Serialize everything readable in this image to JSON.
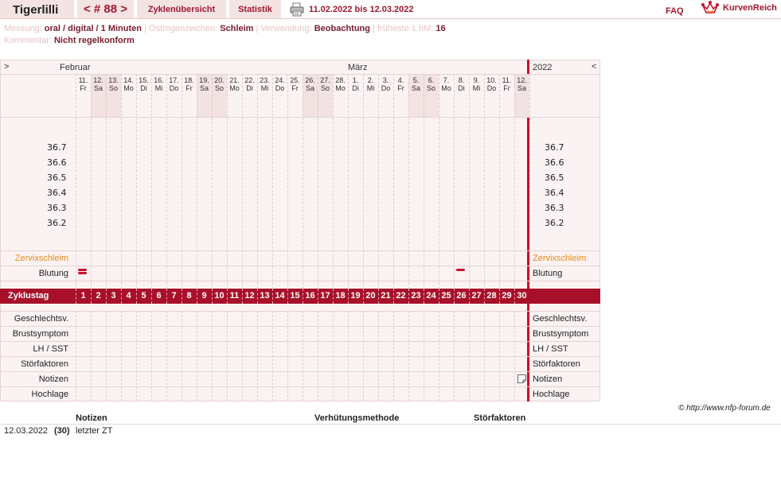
{
  "header": {
    "title": "Tigerlilli",
    "cycle_nav": "< # 88 >",
    "tab_overview": "Zyklenübersicht",
    "tab_stats": "Statistik",
    "date_range": "11.02.2022 bis 12.03.2022",
    "faq": "FAQ",
    "logo_text": "KurvenReich"
  },
  "info": {
    "measurement_label": "Messung:",
    "measurement_value": "oral / digital / 1 Minuten",
    "estrogen_label": "Östrogenzeichen:",
    "estrogen_value": "Schleim",
    "usage_label": "Verwendung:",
    "usage_value": "Beobachtung",
    "earliest_label": "früheste 1.hM:",
    "earliest_value": "16",
    "comment_label": "Kommentar:",
    "comment_value": "Nicht regelkonform"
  },
  "chart": {
    "nav_left": ">",
    "nav_right": "<",
    "month_feb": "Februar",
    "month_mar": "März",
    "year": "2022",
    "days": [
      {
        "d": "11.",
        "w": "Fr",
        "we": false
      },
      {
        "d": "12.",
        "w": "Sa",
        "we": true
      },
      {
        "d": "13.",
        "w": "So",
        "we": true
      },
      {
        "d": "14.",
        "w": "Mo",
        "we": false
      },
      {
        "d": "15.",
        "w": "Di",
        "we": false
      },
      {
        "d": "16.",
        "w": "Mi",
        "we": false
      },
      {
        "d": "17.",
        "w": "Do",
        "we": false
      },
      {
        "d": "18.",
        "w": "Fr",
        "we": false
      },
      {
        "d": "19.",
        "w": "Sa",
        "we": true
      },
      {
        "d": "20.",
        "w": "So",
        "we": true
      },
      {
        "d": "21.",
        "w": "Mo",
        "we": false
      },
      {
        "d": "22.",
        "w": "Di",
        "we": false
      },
      {
        "d": "23.",
        "w": "Mi",
        "we": false
      },
      {
        "d": "24.",
        "w": "Do",
        "we": false
      },
      {
        "d": "25.",
        "w": "Fr",
        "we": false
      },
      {
        "d": "26.",
        "w": "Sa",
        "we": true
      },
      {
        "d": "27.",
        "w": "So",
        "we": true
      },
      {
        "d": "28.",
        "w": "Mo",
        "we": false
      },
      {
        "d": "1.",
        "w": "Di",
        "we": false
      },
      {
        "d": "2.",
        "w": "Mi",
        "we": false
      },
      {
        "d": "3.",
        "w": "Do",
        "we": false
      },
      {
        "d": "4.",
        "w": "Fr",
        "we": false
      },
      {
        "d": "5.",
        "w": "Sa",
        "we": true
      },
      {
        "d": "6.",
        "w": "So",
        "we": true
      },
      {
        "d": "7.",
        "w": "Mo",
        "we": false
      },
      {
        "d": "8.",
        "w": "Di",
        "we": false
      },
      {
        "d": "9.",
        "w": "Mi",
        "we": false
      },
      {
        "d": "10.",
        "w": "Do",
        "we": false
      },
      {
        "d": "11.",
        "w": "Fr",
        "we": false
      },
      {
        "d": "12.",
        "w": "Sa",
        "we": true
      }
    ],
    "temps": [
      "36.7",
      "36.6",
      "36.5",
      "36.4",
      "36.3",
      "36.2"
    ],
    "cycle_label": "Zyklustag",
    "cycle_days": [
      1,
      2,
      3,
      4,
      5,
      6,
      7,
      8,
      9,
      10,
      11,
      12,
      13,
      14,
      15,
      16,
      17,
      18,
      19,
      20,
      21,
      22,
      23,
      24,
      25,
      26,
      27,
      28,
      29,
      30
    ],
    "row_cervix": "Zervixschleim",
    "row_bleeding": "Blutung",
    "bleeding_days": [
      1,
      26
    ],
    "bleeding_strength": [
      2,
      1
    ],
    "note_day": 30,
    "rows_lower": [
      "Geschlechtsv.",
      "Brustsymptom",
      "LH / SST",
      "Störfaktoren",
      "Notizen",
      "Hochlage"
    ]
  },
  "copyright": "© http://www.nfp-forum.de",
  "notes_table": {
    "col_notes": "Notizen",
    "col_method": "Verhütungsmethode",
    "col_disruptions": "Störfaktoren",
    "rows": [
      {
        "date": "12.03.2022",
        "day": "(30)",
        "note": "letzter ZT"
      }
    ]
  },
  "colors": {
    "accent": "#a01830",
    "cycle_bar": "#a8102a",
    "divider": "#c8102e",
    "cervix": "#e8891a"
  }
}
